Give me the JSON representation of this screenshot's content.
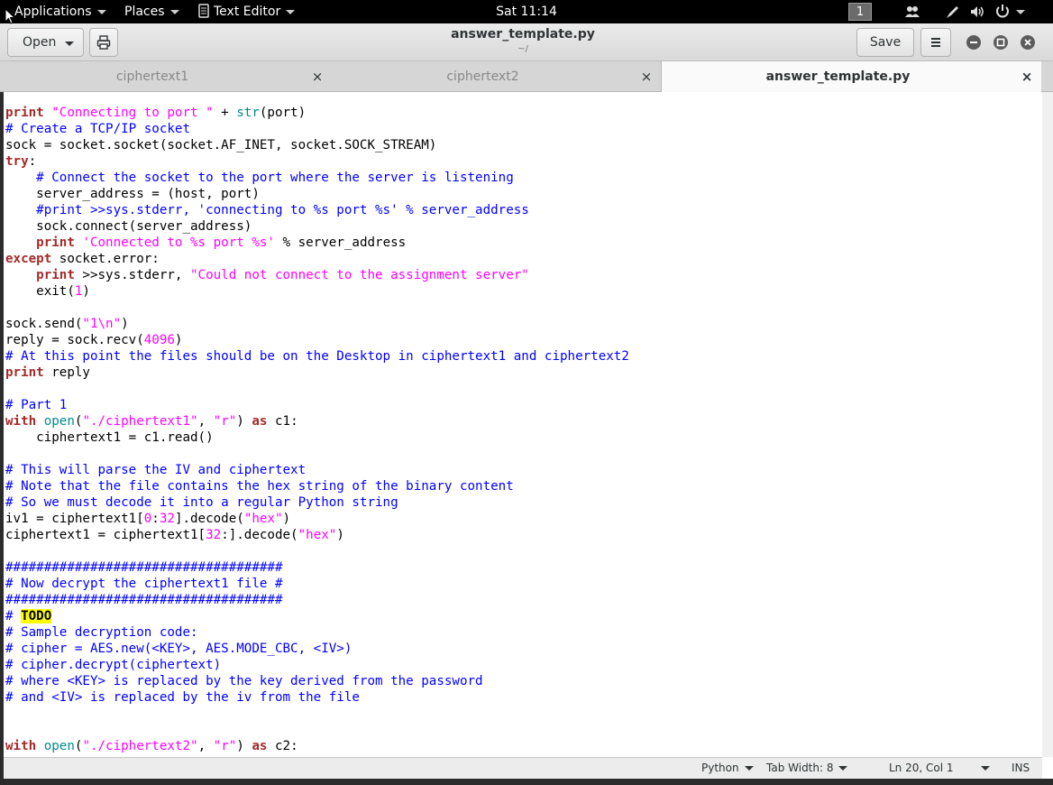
{
  "top_panel": {
    "applications": "Applications",
    "places": "Places",
    "app_name": "Text Editor",
    "clock": "Sat 11:14",
    "workspace": "1"
  },
  "header": {
    "open_label": "Open",
    "title": "answer_template.py",
    "subtitle": "~/",
    "save_label": "Save"
  },
  "tabs": [
    {
      "label": "ciphertext1",
      "close": "×"
    },
    {
      "label": "ciphertext2",
      "close": "×"
    },
    {
      "label": "answer_template.py",
      "close": "×"
    }
  ],
  "code_lines": [
    [
      [
        "k",
        "print"
      ],
      [
        "t",
        " "
      ],
      [
        "s",
        "\"Connecting to port \""
      ],
      [
        "t",
        " + "
      ],
      [
        "b",
        "str"
      ],
      [
        "t",
        "(port)"
      ]
    ],
    [
      [
        "c",
        "# Create a TCP/IP socket"
      ]
    ],
    [
      [
        "t",
        "sock = socket.socket(socket.AF_INET, socket.SOCK_STREAM)"
      ]
    ],
    [
      [
        "k",
        "try"
      ],
      [
        "t",
        ":"
      ]
    ],
    [
      [
        "t",
        "    "
      ],
      [
        "c",
        "# Connect the socket to the port where the server is listening"
      ]
    ],
    [
      [
        "t",
        "    server_address = (host, port)"
      ]
    ],
    [
      [
        "t",
        "    "
      ],
      [
        "c",
        "#print >>sys.stderr, 'connecting to %s port %s' % server_address"
      ]
    ],
    [
      [
        "t",
        "    sock.connect(server_address)"
      ]
    ],
    [
      [
        "t",
        "    "
      ],
      [
        "k",
        "print"
      ],
      [
        "t",
        " "
      ],
      [
        "s",
        "'Connected to %s port %s'"
      ],
      [
        "t",
        " % server_address"
      ]
    ],
    [
      [
        "k",
        "except"
      ],
      [
        "t",
        " socket.error:"
      ]
    ],
    [
      [
        "t",
        "    "
      ],
      [
        "k",
        "print"
      ],
      [
        "t",
        " >>sys.stderr, "
      ],
      [
        "s",
        "\"Could not connect to the assignment server\""
      ]
    ],
    [
      [
        "t",
        "    exit("
      ],
      [
        "s",
        "1"
      ],
      [
        "t",
        ")"
      ]
    ],
    [
      [
        "t",
        ""
      ]
    ],
    [
      [
        "t",
        "sock.send("
      ],
      [
        "s",
        "\"1\\n\""
      ],
      [
        "t",
        ")"
      ]
    ],
    [
      [
        "t",
        "reply = sock.recv("
      ],
      [
        "s",
        "4096"
      ],
      [
        "t",
        ")"
      ]
    ],
    [
      [
        "c",
        "# At this point the files should be on the Desktop in ciphertext1 and ciphertext2"
      ]
    ],
    [
      [
        "k",
        "print"
      ],
      [
        "t",
        " reply"
      ]
    ],
    [
      [
        "t",
        ""
      ]
    ],
    [
      [
        "c",
        "# Part 1"
      ]
    ],
    [
      [
        "k",
        "with"
      ],
      [
        "t",
        " "
      ],
      [
        "b",
        "open"
      ],
      [
        "t",
        "("
      ],
      [
        "s",
        "\"./ciphertext1\""
      ],
      [
        "t",
        ", "
      ],
      [
        "s",
        "\"r\""
      ],
      [
        "t",
        ") "
      ],
      [
        "k",
        "as"
      ],
      [
        "t",
        " c1:"
      ]
    ],
    [
      [
        "t",
        "    ciphertext1 = c1.read()"
      ]
    ],
    [
      [
        "t",
        ""
      ]
    ],
    [
      [
        "c",
        "# This will parse the IV and ciphertext"
      ]
    ],
    [
      [
        "c",
        "# Note that the file contains the hex string of the binary content"
      ]
    ],
    [
      [
        "c",
        "# So we must decode it into a regular Python string"
      ]
    ],
    [
      [
        "t",
        "iv1 = ciphertext1["
      ],
      [
        "s",
        "0"
      ],
      [
        "t",
        ":"
      ],
      [
        "s",
        "32"
      ],
      [
        "t",
        "].decode("
      ],
      [
        "s",
        "\"hex\""
      ],
      [
        "t",
        ")"
      ]
    ],
    [
      [
        "t",
        "ciphertext1 = ciphertext1["
      ],
      [
        "s",
        "32"
      ],
      [
        "t",
        ":].decode("
      ],
      [
        "s",
        "\"hex\""
      ],
      [
        "t",
        ")"
      ]
    ],
    [
      [
        "t",
        ""
      ]
    ],
    [
      [
        "c",
        "####################################"
      ]
    ],
    [
      [
        "c",
        "# Now decrypt the ciphertext1 file #"
      ]
    ],
    [
      [
        "c",
        "####################################"
      ]
    ],
    [
      [
        "c",
        "# "
      ],
      [
        "todo",
        "TODO"
      ]
    ],
    [
      [
        "c",
        "# Sample decryption code:"
      ]
    ],
    [
      [
        "c",
        "# cipher = AES.new(<KEY>, AES.MODE_CBC, <IV>)"
      ]
    ],
    [
      [
        "c",
        "# cipher.decrypt(ciphertext)"
      ]
    ],
    [
      [
        "c",
        "# where <KEY> is replaced by the key derived from the password"
      ]
    ],
    [
      [
        "c",
        "# and <IV> is replaced by the iv from the file"
      ]
    ],
    [
      [
        "t",
        ""
      ]
    ],
    [
      [
        "t",
        ""
      ]
    ],
    [
      [
        "k",
        "with"
      ],
      [
        "t",
        " "
      ],
      [
        "b",
        "open"
      ],
      [
        "t",
        "("
      ],
      [
        "s",
        "\"./ciphertext2\""
      ],
      [
        "t",
        ", "
      ],
      [
        "s",
        "\"r\""
      ],
      [
        "t",
        ") "
      ],
      [
        "k",
        "as"
      ],
      [
        "t",
        " c2:"
      ]
    ]
  ],
  "status": {
    "language": "Python",
    "tab_width": "Tab Width: 8",
    "position": "Ln 20, Col 1",
    "mode": "INS"
  },
  "icons": [
    "cursor-icon",
    "print-icon",
    "menu-icon",
    "minimize-icon",
    "maximize-icon",
    "close-icon",
    "notebook-icon",
    "people-icon",
    "pen-icon",
    "volume-icon",
    "power-icon"
  ]
}
